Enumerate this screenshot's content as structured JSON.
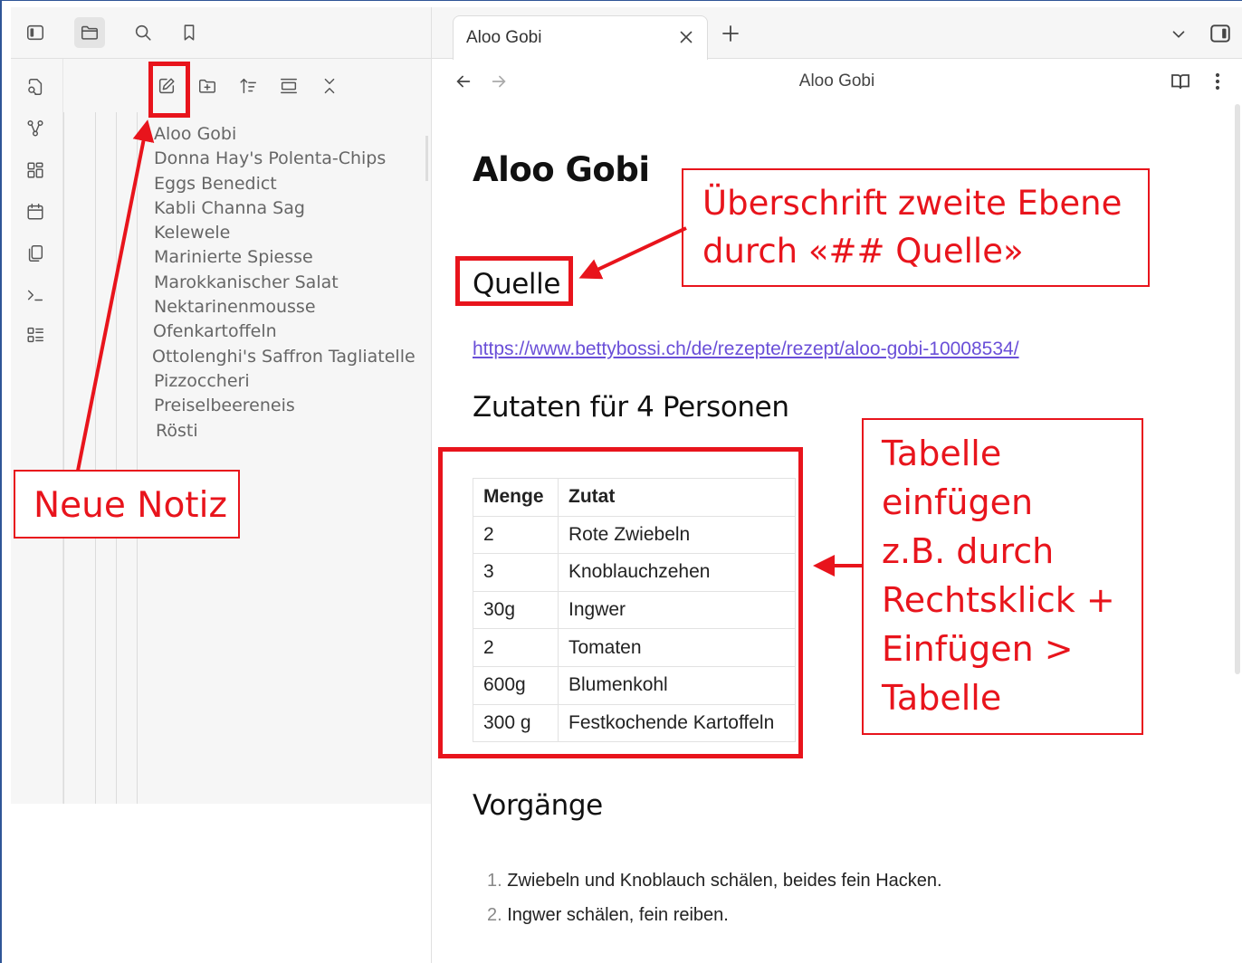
{
  "sidebar": {
    "toolbar": {
      "toggle_icon": "sidebar-toggle-icon",
      "files_icon": "folder-icon",
      "search_icon": "search-icon",
      "bookmark_icon": "bookmark-icon"
    },
    "ribbon": [
      "quick-switcher-icon",
      "graph-icon",
      "canvas-icon",
      "calendar-icon",
      "templates-icon",
      "command-palette-icon",
      "bases-icon"
    ],
    "file_nav": [
      "new-note-icon",
      "new-folder-icon",
      "sort-icon",
      "auto-reveal-icon",
      "collapse-all-icon"
    ],
    "files": [
      "Aloo Gobi",
      "Donna Hay's Polenta-Chips",
      "Eggs Benedict",
      "Kabli Channa Sag",
      "Kelewele",
      "Marinierte Spiesse",
      "Marokkanischer Salat",
      "Nektarinenmousse",
      "Ofenkartoffeln",
      "Ottolenghi's Saffron Tagliatelle",
      "Pizzoccheri",
      "Preiselbeereneis",
      "Rösti"
    ]
  },
  "tab": {
    "title": "Aloo Gobi"
  },
  "view": {
    "title": "Aloo Gobi"
  },
  "note": {
    "title": "Aloo Gobi",
    "source_heading": "Quelle",
    "source_link": "https://www.bettybossi.ch/de/rezepte/rezept/aloo-gobi-10008534/",
    "ingredients_heading": "Zutaten für 4 Personen",
    "table": {
      "headers": [
        "Menge",
        "Zutat"
      ],
      "rows": [
        [
          "2",
          "Rote Zwiebeln"
        ],
        [
          "3",
          "Knoblauchzehen"
        ],
        [
          "30g",
          "Ingwer"
        ],
        [
          "2",
          "Tomaten"
        ],
        [
          "600g",
          "Blumenkohl"
        ],
        [
          "300 g",
          "Festkochende Kartoffeln"
        ]
      ]
    },
    "steps_heading": "Vorgänge",
    "steps": [
      {
        "num": "1.",
        "text": "Zwiebeln und Knoblauch schälen, beides fein Hacken."
      },
      {
        "num": "2.",
        "text": "Ingwer schälen, fein reiben."
      }
    ]
  },
  "annotations": {
    "new_note": "Neue Notiz",
    "heading_line1": "Überschrift zweite Ebene",
    "heading_line2": "durch «## Quelle»",
    "table_lines": [
      "Tabelle",
      "einfügen",
      "z.B. durch",
      "Rechtsklick +",
      "Einfügen >",
      "Tabelle"
    ],
    "color": "#e8141c"
  }
}
